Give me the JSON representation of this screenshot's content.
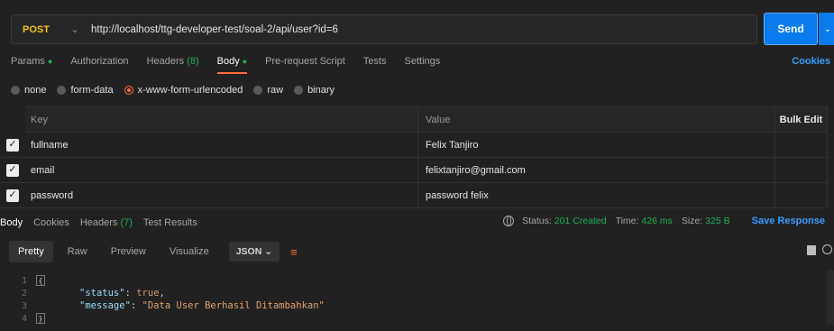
{
  "request": {
    "method": "POST",
    "url": "http://localhost/ttg-developer-test/soal-2/api/user?id=6",
    "send_label": "Send"
  },
  "request_tabs": {
    "params": "Params",
    "authorization": "Authorization",
    "headers": "Headers",
    "headers_count": "(8)",
    "body": "Body",
    "prerequest": "Pre-request Script",
    "tests": "Tests",
    "settings": "Settings",
    "cookies": "Cookies"
  },
  "body_types": [
    "none",
    "form-data",
    "x-www-form-urlencoded",
    "raw",
    "binary"
  ],
  "body_type_selected": "x-www-form-urlencoded",
  "params_table": {
    "headers": {
      "key": "Key",
      "value": "Value",
      "bulk": "Bulk Edit"
    },
    "rows": [
      {
        "key": "fullname",
        "value": "Felix Tanjiro",
        "checked": true
      },
      {
        "key": "email",
        "value": "felixtanjiro@gmail.com",
        "checked": true
      },
      {
        "key": "password",
        "value": "password felix",
        "checked": true
      }
    ]
  },
  "response_tabs": {
    "body": "Body",
    "cookies": "Cookies",
    "headers": "Headers",
    "headers_count": "(7)",
    "test_results": "Test Results"
  },
  "response_status": {
    "status_label": "Status:",
    "status_value": "201 Created",
    "time_label": "Time:",
    "time_value": "426 ms",
    "size_label": "Size:",
    "size_value": "325 B",
    "save_label": "Save Response"
  },
  "view_tabs": [
    "Pretty",
    "Raw",
    "Preview",
    "Visualize"
  ],
  "view_selected": "Pretty",
  "format": "JSON",
  "code": {
    "line_numbers": [
      "1",
      "2",
      "3",
      "4"
    ],
    "status_key": "\"status\"",
    "status_value": "true",
    "message_key": "\"message\"",
    "message_value": "\"Data User Berhasil Ditambahkan\""
  },
  "colors": {
    "accent": "#ff6c37",
    "send": "#097bed",
    "method": "#f5c518",
    "success": "#20b15a",
    "link": "#3a9cff"
  }
}
